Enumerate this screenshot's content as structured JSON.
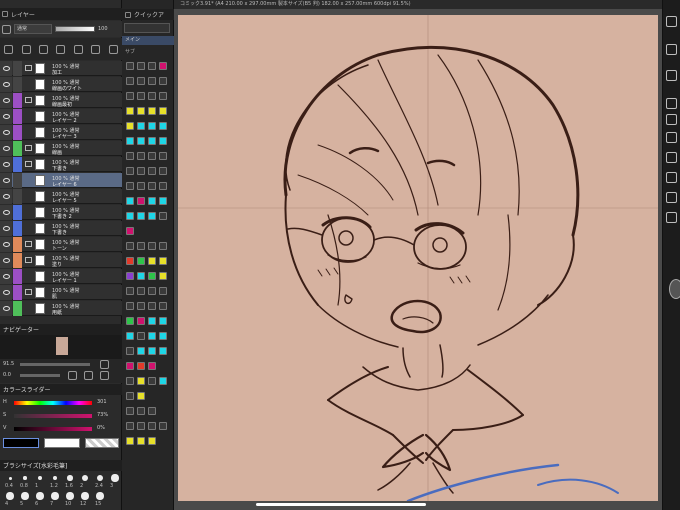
{
  "layer_panel": {
    "title": "レイヤー",
    "blend_mode": "通常",
    "opacity_value": "100",
    "layers": [
      {
        "opacity": "100 % 通常",
        "name": "加工",
        "color": "#444",
        "folder": true,
        "selected": false
      },
      {
        "opacity": "100 % 通常",
        "name": "線画のワイト",
        "color": "#444",
        "folder": false,
        "selected": false
      },
      {
        "opacity": "100 % 通常",
        "name": "線画最初",
        "color": "#9c4fc4",
        "folder": true,
        "selected": false
      },
      {
        "opacity": "100 % 通常",
        "name": "レイヤー 2",
        "color": "#9c4fc4",
        "folder": false,
        "selected": false
      },
      {
        "opacity": "100 % 通常",
        "name": "レイヤー 3",
        "color": "#9c4fc4",
        "folder": false,
        "selected": false
      },
      {
        "opacity": "100 % 通常",
        "name": "線画",
        "color": "#4fbf5a",
        "folder": true,
        "selected": false
      },
      {
        "opacity": "100 % 通常",
        "name": "下書き",
        "color": "#4f6fd8",
        "folder": true,
        "selected": false
      },
      {
        "opacity": "100 % 通常",
        "name": "レイヤー 6",
        "color": "#444",
        "folder": false,
        "selected": true
      },
      {
        "opacity": "100 % 通常",
        "name": "レイヤー 5",
        "color": "#444",
        "folder": false,
        "selected": false
      },
      {
        "opacity": "100 % 通常",
        "name": "下書き 2",
        "color": "#4f6fd8",
        "folder": false,
        "selected": false
      },
      {
        "opacity": "100 % 通常",
        "name": "下書き",
        "color": "#4f6fd8",
        "folder": false,
        "selected": false
      },
      {
        "opacity": "100 % 通常",
        "name": "トーン",
        "color": "#e08a5a",
        "folder": true,
        "selected": false
      },
      {
        "opacity": "100 % 通常",
        "name": "塗り",
        "color": "#e08a5a",
        "folder": true,
        "selected": false
      },
      {
        "opacity": "100 % 通常",
        "name": "レイヤー 1",
        "color": "#9c4fc4",
        "folder": false,
        "selected": false
      },
      {
        "opacity": "100 % 通常",
        "name": "肌",
        "color": "#9c4fc4",
        "folder": true,
        "selected": false
      },
      {
        "opacity": "100 % 通常",
        "name": "用紙",
        "color": "#4fbf5a",
        "folder": false,
        "selected": false
      }
    ]
  },
  "navigator": {
    "title": "ナビゲーター",
    "zoom": "91.5",
    "rotation": "0.0"
  },
  "color_slider": {
    "title": "カラースライダー",
    "h_label": "H",
    "h_value": "301",
    "s_label": "S",
    "s_value": "73%",
    "v_label": "V",
    "v_value": "0%"
  },
  "brush_size": {
    "title": "ブラシサイズ[水彩毛筆]",
    "sizes": [
      "0.4",
      "0.8",
      "1",
      "1.2",
      "1.6",
      "2",
      "2.4",
      "3",
      "4",
      "5",
      "6",
      "7",
      "10",
      "12",
      "15"
    ]
  },
  "tool_palette": {
    "quick_access_title": "クイックア",
    "main_tab": "メイン",
    "sub_tab": "サブ"
  },
  "canvas": {
    "title_text": "コミック3.91* (A4 210.00 x 297.00mm 製本サイズ(B5 判) 182.00 x 257.00mm 600dpi 91.5%)",
    "paper_color": "#d6b2a0",
    "line_color": "#3a1e16"
  },
  "colors": {
    "panel_bg": "#2b2b2b",
    "selected_layer": "#5a6a86",
    "yellow_icon": "#e7e02a",
    "cyan_icon": "#1fd6e6",
    "magenta_icon": "#d0126e",
    "red_icon": "#e23a2a",
    "green_icon": "#2ec44a",
    "purple_icon": "#8a3fd0"
  }
}
